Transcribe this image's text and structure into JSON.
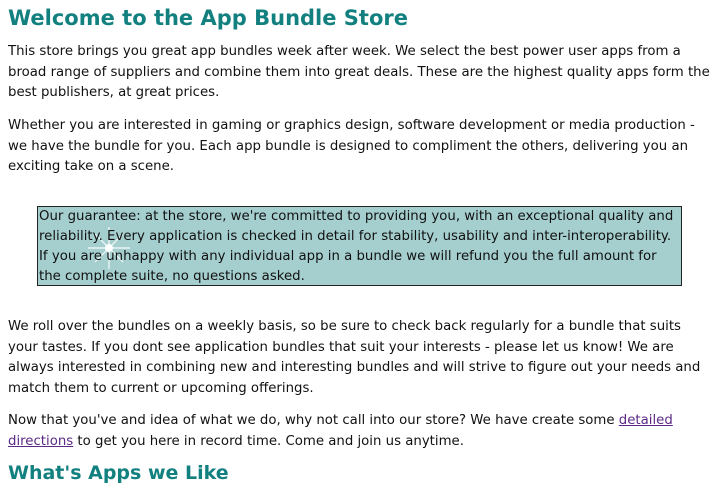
{
  "header": {
    "title": "Welcome to the App Bundle Store"
  },
  "intro": {
    "p1": "This store brings you great app bundles week after week. We select the best power user apps from a broad range of suppliers and combine them into great deals. These are the highest quality apps form the best publishers, at great prices.",
    "p2": "Whether you are interested in gaming or graphics design, software development or media production - we have the bundle for you. Each app bundle is designed to compliment the others, delivering you an exciting take on a scene."
  },
  "guarantee": {
    "text": "Our guarantee: at the store, we're committed to providing you, with an exceptional quality and reliability. Every application is checked in detail for stability, usability and inter-interoperability. If you are unhappy with any individual app in a bundle we will refund you the full amount for the complete suite, no questions asked."
  },
  "body": {
    "p3": "We roll over the bundles on a weekly basis, so be sure to check back regularly for a bundle that suits your tastes. If you dont see application bundles that suit your interests - please let us know! We are always interested in combining new and interesting bundles and will strive to figure out your needs and match them to current or upcoming offerings.",
    "p4_before": "Now that you've and idea of what we do, why not call into our store? We have create some ",
    "p4_link": "detailed directions",
    "p4_after": " to get you here in record time. Come and join us anytime."
  },
  "section2": {
    "title": "What's Apps we Like"
  }
}
